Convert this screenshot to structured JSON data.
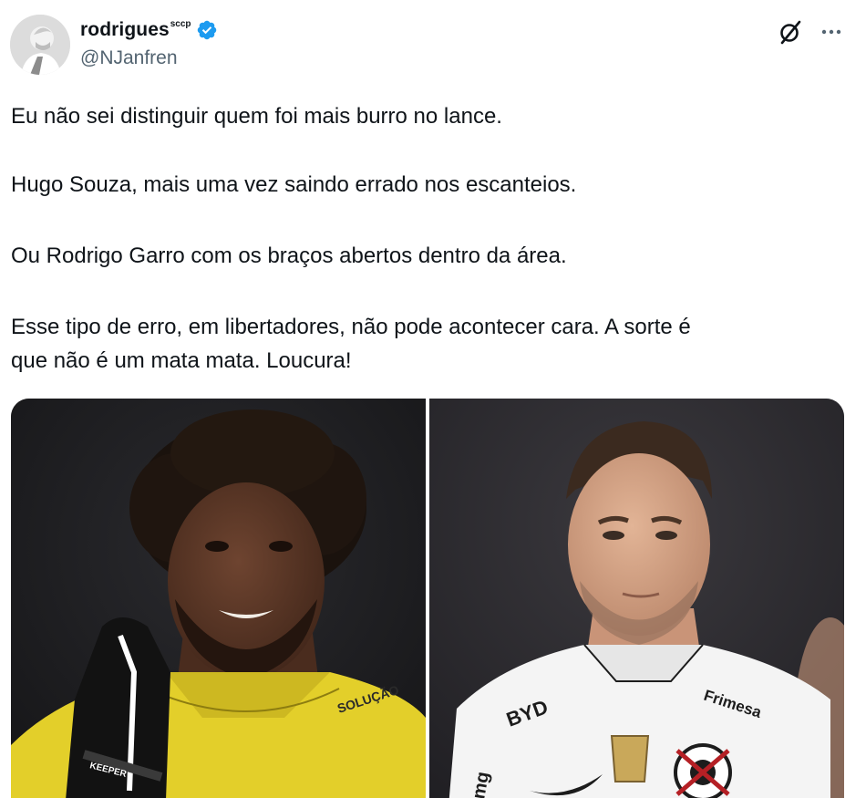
{
  "author": {
    "display_name": "rodrigues",
    "name_suffix": "sccp",
    "handle": "@NJanfren",
    "verified": true,
    "verified_color": "#1d9bf0"
  },
  "icons": {
    "avatar": "avatar-image",
    "verified": "verified-badge-icon",
    "grok": "grok-icon",
    "more": "more-options-icon"
  },
  "tweet": {
    "lines": [
      "Eu não sei distinguir quem foi mais burro no lance.",
      "Hugo Souza, mais uma vez saindo errado nos escanteios.",
      "Ou Rodrigo Garro com os braços abertos dentro da área.",
      "Esse tipo de erro, em libertadores, não pode acontecer cara. A sorte é",
      "que não é um mata mata. Loucura!"
    ]
  },
  "media": {
    "photos": [
      {
        "subject": "goalkeeper in yellow kit",
        "jersey_text": "SOLUÇÃO",
        "glove_text": "KEEPER"
      },
      {
        "subject": "player in white Corinthians kit",
        "sponsor_left": "BYD",
        "sponsor_right": "Frimesa",
        "side_text": "mg"
      }
    ]
  },
  "colors": {
    "text_primary": "#0f1419",
    "text_secondary": "#536471",
    "keeper_yellow": "#e3cf2a",
    "kit_white": "#f4f4f4"
  }
}
